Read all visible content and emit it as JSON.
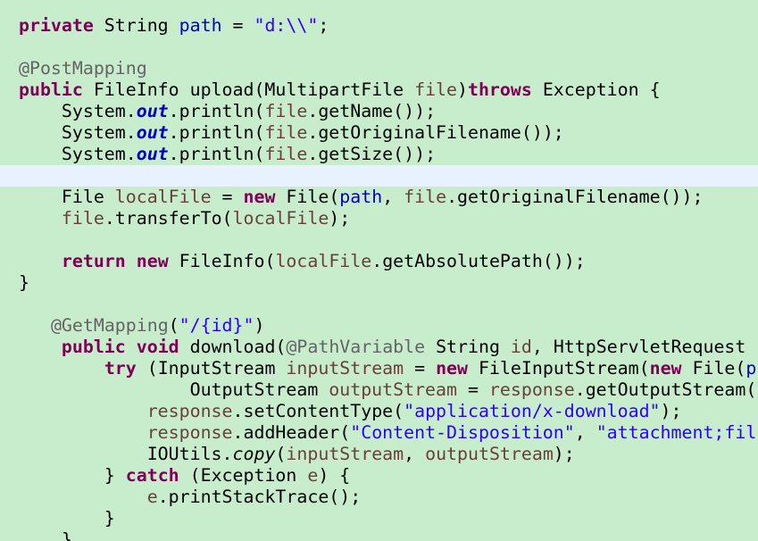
{
  "editor": {
    "theme": {
      "background": "#c7edcc",
      "current_line": "#e8f2fe",
      "keyword": "#7f0055",
      "annotation": "#646464",
      "field": "#0000c0",
      "local_variable": "#6a3e3e",
      "string": "#2a00ff"
    },
    "current_line_index": 7,
    "lines": [
      [
        {
          "t": "private",
          "k": "keyword"
        },
        {
          "t": " String ",
          "k": "plain"
        },
        {
          "t": "path",
          "k": "field"
        },
        {
          "t": " = ",
          "k": "plain"
        },
        {
          "t": "\"d:\\\\\"",
          "k": "string"
        },
        {
          "t": ";",
          "k": "plain"
        }
      ],
      [],
      [
        {
          "t": "@PostMapping",
          "k": "annotation"
        }
      ],
      [
        {
          "t": "public",
          "k": "keyword"
        },
        {
          "t": " FileInfo upload(MultipartFile ",
          "k": "plain"
        },
        {
          "t": "file",
          "k": "param"
        },
        {
          "t": ")",
          "k": "plain"
        },
        {
          "t": "throws",
          "k": "keyword"
        },
        {
          "t": " Exception {",
          "k": "plain"
        }
      ],
      [
        {
          "t": "    System.",
          "k": "plain"
        },
        {
          "t": "out",
          "k": "static-field"
        },
        {
          "t": ".println(",
          "k": "plain"
        },
        {
          "t": "file",
          "k": "param"
        },
        {
          "t": ".getName());",
          "k": "plain"
        }
      ],
      [
        {
          "t": "    System.",
          "k": "plain"
        },
        {
          "t": "out",
          "k": "static-field"
        },
        {
          "t": ".println(",
          "k": "plain"
        },
        {
          "t": "file",
          "k": "param"
        },
        {
          "t": ".getOriginalFilename());",
          "k": "plain"
        }
      ],
      [
        {
          "t": "    System.",
          "k": "plain"
        },
        {
          "t": "out",
          "k": "static-field"
        },
        {
          "t": ".println(",
          "k": "plain"
        },
        {
          "t": "file",
          "k": "param"
        },
        {
          "t": ".getSize());",
          "k": "plain"
        }
      ],
      [],
      [
        {
          "t": "    File ",
          "k": "plain"
        },
        {
          "t": "localFile",
          "k": "local"
        },
        {
          "t": " = ",
          "k": "plain"
        },
        {
          "t": "new",
          "k": "keyword"
        },
        {
          "t": " File(",
          "k": "plain"
        },
        {
          "t": "path",
          "k": "field"
        },
        {
          "t": ", ",
          "k": "plain"
        },
        {
          "t": "file",
          "k": "param"
        },
        {
          "t": ".getOriginalFilename());",
          "k": "plain"
        }
      ],
      [
        {
          "t": "    ",
          "k": "plain"
        },
        {
          "t": "file",
          "k": "param"
        },
        {
          "t": ".transferTo(",
          "k": "plain"
        },
        {
          "t": "localFile",
          "k": "local"
        },
        {
          "t": ");",
          "k": "plain"
        }
      ],
      [],
      [
        {
          "t": "    ",
          "k": "plain"
        },
        {
          "t": "return",
          "k": "keyword"
        },
        {
          "t": " ",
          "k": "plain"
        },
        {
          "t": "new",
          "k": "keyword"
        },
        {
          "t": " FileInfo(",
          "k": "plain"
        },
        {
          "t": "localFile",
          "k": "local"
        },
        {
          "t": ".getAbsolutePath());",
          "k": "plain"
        }
      ],
      [
        {
          "t": "}",
          "k": "plain"
        }
      ],
      [],
      [
        {
          "t": "   ",
          "k": "plain"
        },
        {
          "t": "@GetMapping",
          "k": "annotation"
        },
        {
          "t": "(",
          "k": "plain"
        },
        {
          "t": "\"/{id}\"",
          "k": "string"
        },
        {
          "t": ")",
          "k": "plain"
        }
      ],
      [
        {
          "t": "    ",
          "k": "plain"
        },
        {
          "t": "public",
          "k": "keyword"
        },
        {
          "t": " ",
          "k": "plain"
        },
        {
          "t": "void",
          "k": "keyword"
        },
        {
          "t": " download(",
          "k": "plain"
        },
        {
          "t": "@PathVariable",
          "k": "annotation"
        },
        {
          "t": " String ",
          "k": "plain"
        },
        {
          "t": "id",
          "k": "param"
        },
        {
          "t": ", HttpServletRequest",
          "k": "plain"
        }
      ],
      [
        {
          "t": "        ",
          "k": "plain"
        },
        {
          "t": "try",
          "k": "keyword"
        },
        {
          "t": " (InputStream ",
          "k": "plain"
        },
        {
          "t": "inputStream",
          "k": "local"
        },
        {
          "t": " = ",
          "k": "plain"
        },
        {
          "t": "new",
          "k": "keyword"
        },
        {
          "t": " FileInputStream(",
          "k": "plain"
        },
        {
          "t": "new",
          "k": "keyword"
        },
        {
          "t": " File(",
          "k": "plain"
        },
        {
          "t": "p",
          "k": "field"
        }
      ],
      [
        {
          "t": "                OutputStream ",
          "k": "plain"
        },
        {
          "t": "outputStream",
          "k": "local"
        },
        {
          "t": " = ",
          "k": "plain"
        },
        {
          "t": "response",
          "k": "param"
        },
        {
          "t": ".getOutputStream(",
          "k": "plain"
        }
      ],
      [
        {
          "t": "            ",
          "k": "plain"
        },
        {
          "t": "response",
          "k": "param"
        },
        {
          "t": ".setContentType(",
          "k": "plain"
        },
        {
          "t": "\"application/x-download\"",
          "k": "string"
        },
        {
          "t": ");",
          "k": "plain"
        }
      ],
      [
        {
          "t": "            ",
          "k": "plain"
        },
        {
          "t": "response",
          "k": "param"
        },
        {
          "t": ".addHeader(",
          "k": "plain"
        },
        {
          "t": "\"Content-Disposition\"",
          "k": "string"
        },
        {
          "t": ", ",
          "k": "plain"
        },
        {
          "t": "\"attachment;fil",
          "k": "string"
        }
      ],
      [
        {
          "t": "            IOUtils.",
          "k": "plain"
        },
        {
          "t": "copy",
          "k": "static-method"
        },
        {
          "t": "(",
          "k": "plain"
        },
        {
          "t": "inputStream",
          "k": "local"
        },
        {
          "t": ", ",
          "k": "plain"
        },
        {
          "t": "outputStream",
          "k": "local"
        },
        {
          "t": ");",
          "k": "plain"
        }
      ],
      [
        {
          "t": "        } ",
          "k": "plain"
        },
        {
          "t": "catch",
          "k": "keyword"
        },
        {
          "t": " (Exception ",
          "k": "plain"
        },
        {
          "t": "e",
          "k": "param"
        },
        {
          "t": ") {",
          "k": "plain"
        }
      ],
      [
        {
          "t": "            ",
          "k": "plain"
        },
        {
          "t": "e",
          "k": "param"
        },
        {
          "t": ".printStackTrace();",
          "k": "plain"
        }
      ],
      [
        {
          "t": "        }",
          "k": "plain"
        }
      ],
      [
        {
          "t": "    }",
          "k": "plain"
        }
      ]
    ]
  }
}
